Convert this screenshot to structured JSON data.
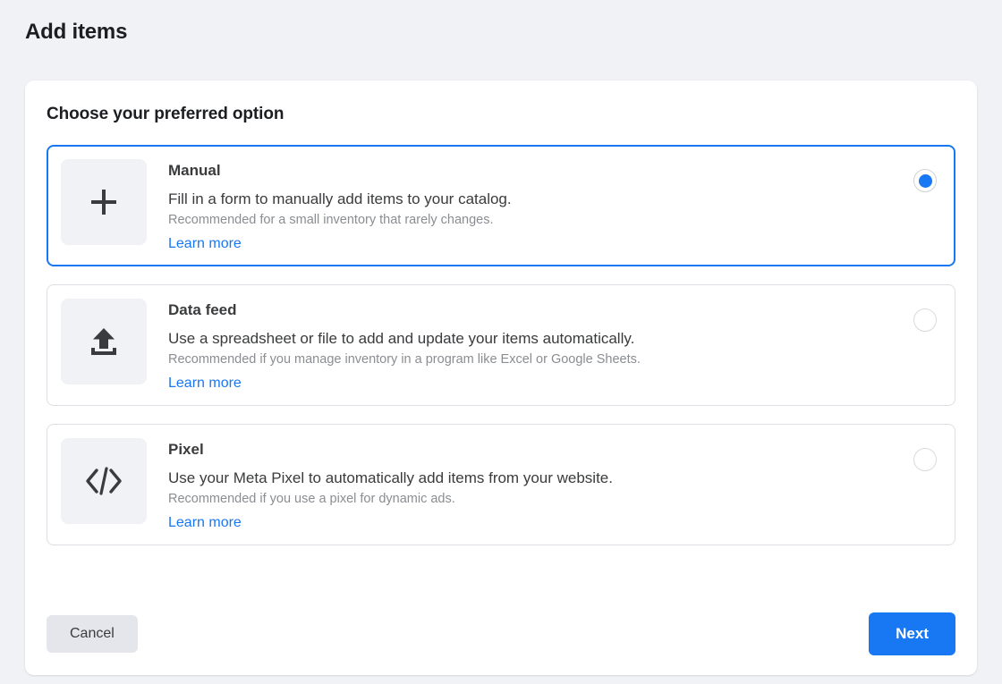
{
  "page": {
    "title": "Add items",
    "background_color": "#f0f2f5"
  },
  "panel": {
    "heading": "Choose your preferred option",
    "accent_color": "#1877f2"
  },
  "options": [
    {
      "id": "manual",
      "icon": "plus-icon",
      "title": "Manual",
      "description": "Fill in a form to manually add items to your catalog.",
      "recommendation": "Recommended for a small inventory that rarely changes.",
      "link_label": "Learn more",
      "selected": true
    },
    {
      "id": "data-feed",
      "icon": "upload-icon",
      "title": "Data feed",
      "description": "Use a spreadsheet or file to add and update your items automatically.",
      "recommendation": "Recommended if you manage inventory in a program like Excel or Google Sheets.",
      "link_label": "Learn more",
      "selected": false
    },
    {
      "id": "pixel",
      "icon": "code-brackets-icon",
      "title": "Pixel",
      "description": "Use your Meta Pixel to automatically add items from your website.",
      "recommendation": "Recommended if you use a pixel for dynamic ads.",
      "link_label": "Learn more",
      "selected": false
    }
  ],
  "footer": {
    "cancel_label": "Cancel",
    "next_label": "Next"
  }
}
